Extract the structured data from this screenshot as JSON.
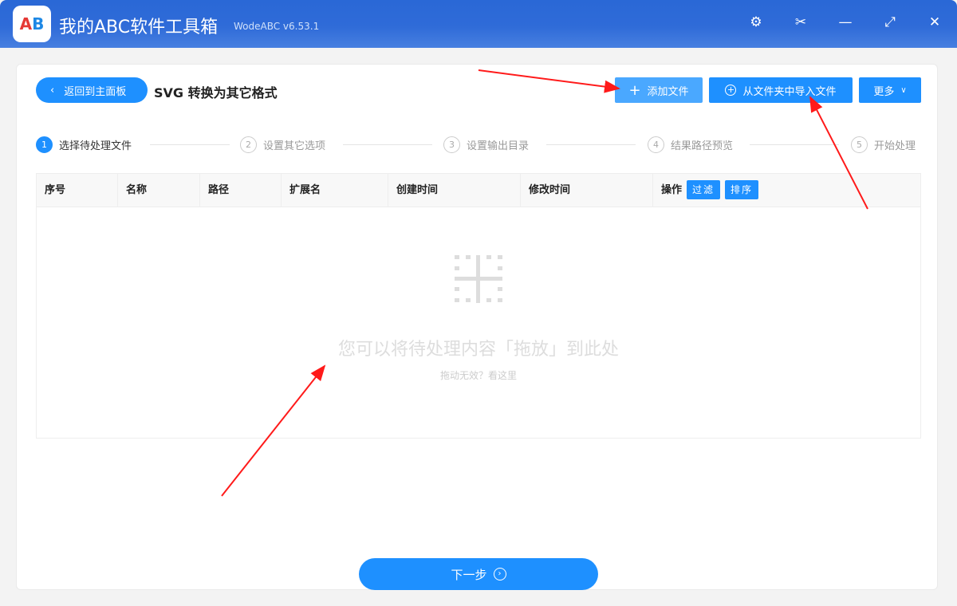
{
  "app": {
    "title": "我的ABC软件工具箱",
    "version": "WodeABC v6.53.1",
    "logo_text": "AB"
  },
  "titlebar_icons": [
    "settings-icon",
    "scissors-icon",
    "minimize-icon",
    "maximize-icon",
    "close-icon"
  ],
  "header": {
    "back_label": "返回到主面板",
    "page_title": "SVG 转换为其它格式",
    "add_file": "添加文件",
    "import_folder": "从文件夹中导入文件",
    "more": "更多"
  },
  "steps": [
    {
      "num": "1",
      "label": "选择待处理文件"
    },
    {
      "num": "2",
      "label": "设置其它选项"
    },
    {
      "num": "3",
      "label": "设置输出目录"
    },
    {
      "num": "4",
      "label": "结果路径预览"
    },
    {
      "num": "5",
      "label": "开始处理"
    }
  ],
  "table": {
    "columns": [
      "序号",
      "名称",
      "路径",
      "扩展名",
      "创建时间",
      "修改时间",
      "操作"
    ],
    "filter": "过滤",
    "sort": "排序"
  },
  "empty": {
    "message": "您可以将待处理内容「拖放」到此处",
    "help": "拖动无效？看这里"
  },
  "footer": {
    "next": "下一步"
  },
  "colors": {
    "accent": "#1e90ff",
    "titlebar": "#2a68d6",
    "annotation": "#ff1a1a"
  }
}
